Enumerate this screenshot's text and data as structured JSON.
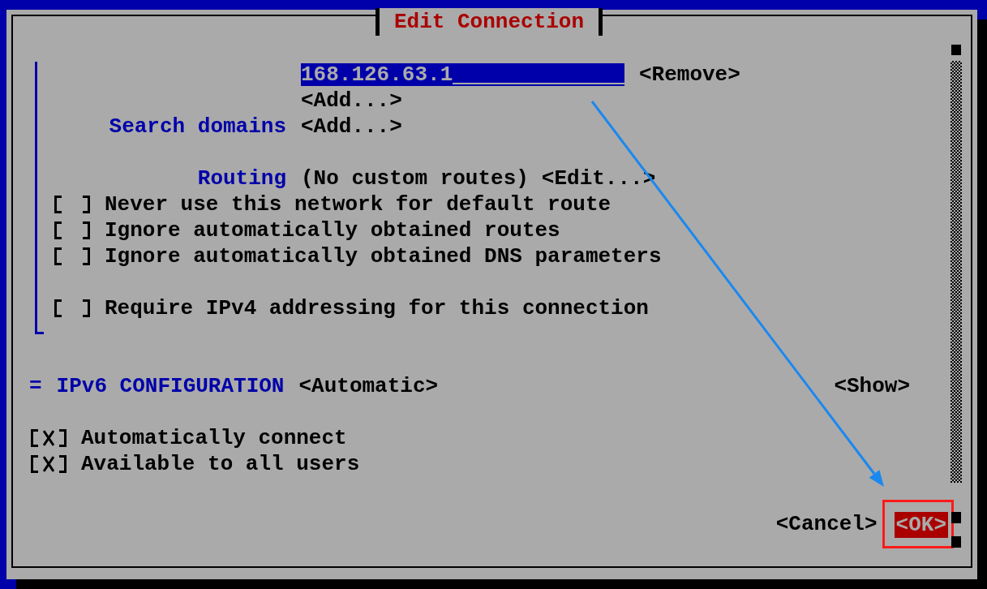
{
  "window": {
    "title": "Edit Connection"
  },
  "dns": {
    "server": {
      "value": "168.126.63.1",
      "selected": true
    },
    "remove": "<Remove>",
    "add": "<Add...>"
  },
  "search_domains": {
    "label": "Search domains",
    "add": "<Add...>"
  },
  "routing": {
    "label": "Routing",
    "value": "(No custom routes)",
    "edit": "<Edit...>"
  },
  "route_options": [
    {
      "label": "Never use this network for default route",
      "checked": false
    },
    {
      "label": "Ignore automatically obtained routes",
      "checked": false
    },
    {
      "label": "Ignore automatically obtained DNS parameters",
      "checked": false
    }
  ],
  "require_ipv4": {
    "label": "Require IPv4 addressing for this connection",
    "checked": false
  },
  "ipv6": {
    "marker": "=",
    "label": "IPv6 CONFIGURATION",
    "mode": "<Automatic>",
    "show": "<Show>"
  },
  "connection_options": [
    {
      "label": "Automatically connect",
      "checked": true
    },
    {
      "label": "Available to all users",
      "checked": true
    }
  ],
  "buttons": [
    {
      "label": "<Cancel>",
      "selected": false
    },
    {
      "label": "<OK>",
      "selected": true
    }
  ]
}
